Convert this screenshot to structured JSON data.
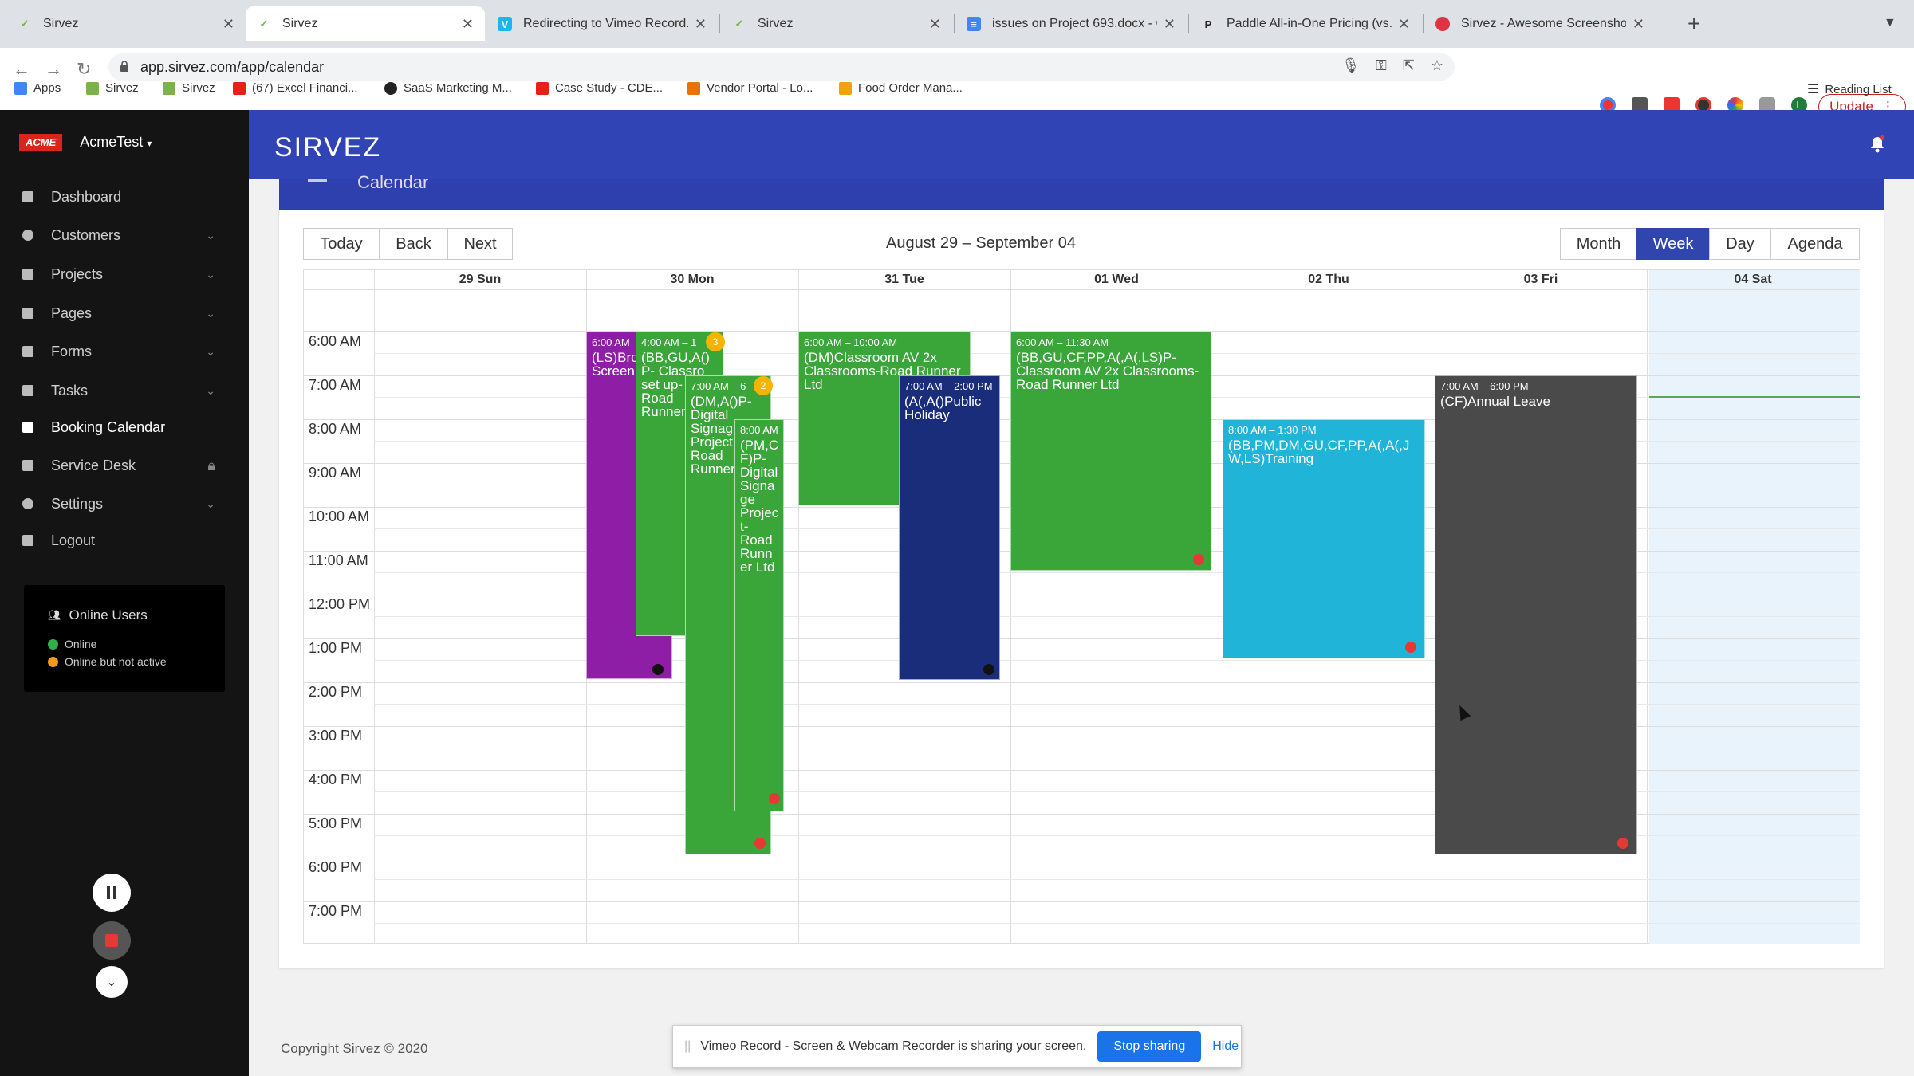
{
  "browser": {
    "tabs": [
      {
        "title": "Sirvez",
        "icon": "sirvez-favicon"
      },
      {
        "title": "Sirvez",
        "icon": "sirvez-favicon"
      },
      {
        "title": "Redirecting to Vimeo Record...",
        "icon": "vimeo-favicon"
      },
      {
        "title": "Sirvez",
        "icon": "sirvez-favicon"
      },
      {
        "title": "issues on Project 693.docx - G",
        "icon": "docs-favicon"
      },
      {
        "title": "Paddle All-in-One Pricing (vs. I",
        "icon": "paddle-favicon"
      },
      {
        "title": "Sirvez - Awesome Screenshot",
        "icon": "screenshot-favicon"
      }
    ],
    "url": "app.sirvez.com/app/calendar",
    "update_label": "Update",
    "profile_initial": "L",
    "bookmarks": [
      {
        "label": "Apps",
        "color": "#4285f4"
      },
      {
        "label": "Sirvez",
        "color": "#7bb24a"
      },
      {
        "label": "Sirvez",
        "color": "#7bb24a"
      },
      {
        "label": "(67) Excel Financi...",
        "color": "#e62117"
      },
      {
        "label": "SaaS Marketing M...",
        "color": "#222222"
      },
      {
        "label": "Case Study - CDE...",
        "color": "#e62117"
      },
      {
        "label": "Vendor Portal - Lo...",
        "color": "#e8710a"
      },
      {
        "label": "Food Order Mana...",
        "color": "#f2a20c"
      }
    ],
    "reading_list": "Reading List"
  },
  "sidebar": {
    "brand_badge": "ACME",
    "org_name": "AcmeTest",
    "items": [
      {
        "label": "Dashboard",
        "icon": "dashboard-icon",
        "chevron": false
      },
      {
        "label": "Customers",
        "icon": "customers-icon",
        "chevron": true
      },
      {
        "label": "Projects",
        "icon": "projects-icon",
        "chevron": true
      },
      {
        "label": "Pages",
        "icon": "pages-icon",
        "chevron": true
      },
      {
        "label": "Forms",
        "icon": "forms-icon",
        "chevron": true
      },
      {
        "label": "Tasks",
        "icon": "tasks-icon",
        "chevron": true
      },
      {
        "label": "Booking Calendar",
        "icon": "calendar-icon",
        "chevron": false,
        "active": true
      },
      {
        "label": "Service Desk",
        "icon": "service-desk-icon",
        "chevron": false,
        "locked": true
      },
      {
        "label": "Settings",
        "icon": "gear-icon",
        "chevron": true
      },
      {
        "label": "Logout",
        "icon": "logout-icon",
        "chevron": false
      }
    ],
    "online_users": {
      "title": "Online Users",
      "legend": [
        {
          "label": "Online",
          "color": "#2fb14a"
        },
        {
          "label": "Online but not active",
          "color": "#f39a1e"
        }
      ]
    }
  },
  "header": {
    "logo": "SIRVEZ",
    "page_title": "Calendar"
  },
  "calendar": {
    "nav": {
      "today": "Today",
      "back": "Back",
      "next": "Next"
    },
    "range": "August 29 – September 04",
    "views": [
      "Month",
      "Week",
      "Day",
      "Agenda"
    ],
    "active_view": "Week",
    "days": [
      "29 Sun",
      "30 Mon",
      "31 Tue",
      "01 Wed",
      "02 Thu",
      "03 Fri",
      "04 Sat"
    ],
    "times": [
      "6:00 AM",
      "7:00 AM",
      "8:00 AM",
      "9:00 AM",
      "10:00 AM",
      "11:00 AM",
      "12:00 PM",
      "1:00 PM",
      "2:00 PM",
      "3:00 PM",
      "4:00 PM",
      "5:00 PM",
      "6:00 PM",
      "7:00 PM"
    ],
    "events": [
      {
        "day": 1,
        "time": "6:00 AM",
        "title": "(LS)Bro Screen",
        "color": "#8e1ea6",
        "dot": "#111111"
      },
      {
        "day": 1,
        "time": "4:00 AM – 1",
        "title": "(BB,GU,A() P- Classro set up- Road Runner",
        "color": "#3aa63a",
        "badge": "3"
      },
      {
        "day": 1,
        "time": "7:00 AM – 6",
        "title": "(DM,A()P- Digital Signag Project Road Runner",
        "color": "#3aa63a",
        "badge": "2",
        "dot": "#e53935"
      },
      {
        "day": 1,
        "time": "8:00 AM",
        "title": "(PM,C F)P- Digital Signa ge Projec t- Road Runn er Ltd",
        "color": "#3aa63a",
        "dot": "#e53935"
      },
      {
        "day": 2,
        "time": "6:00 AM – 10:00 AM",
        "title": "(DM)Classroom AV 2x Classrooms-Road Runner Ltd",
        "color": "#3aa63a"
      },
      {
        "day": 2,
        "time": "7:00 AM – 2:00 PM",
        "title": "(A(,A()Public Holiday",
        "color": "#1a2d7a",
        "dot": "#111111"
      },
      {
        "day": 3,
        "time": "6:00 AM – 11:30 AM",
        "title": "(BB,GU,CF,PP,A(,A(,LS)P- Classroom AV 2x Classrooms- Road Runner Ltd",
        "color": "#3aa63a",
        "dot": "#e53935"
      },
      {
        "day": 4,
        "time": "8:00 AM – 1:30 PM",
        "title": "(BB,PM,DM,GU,CF,PP,A(,A(,J W,LS)Training",
        "color": "#1fb4d8",
        "dot": "#e53935"
      },
      {
        "day": 5,
        "time": "7:00 AM – 6:00 PM",
        "title": "(CF)Annual Leave",
        "color": "#4a4a4a",
        "dot": "#e53935"
      }
    ]
  },
  "footer": {
    "copyright": "Copyright Sirvez © 2020"
  },
  "share_bar": {
    "message": "Vimeo Record - Screen & Webcam Recorder is sharing your screen.",
    "stop": "Stop sharing",
    "hide": "Hide"
  }
}
